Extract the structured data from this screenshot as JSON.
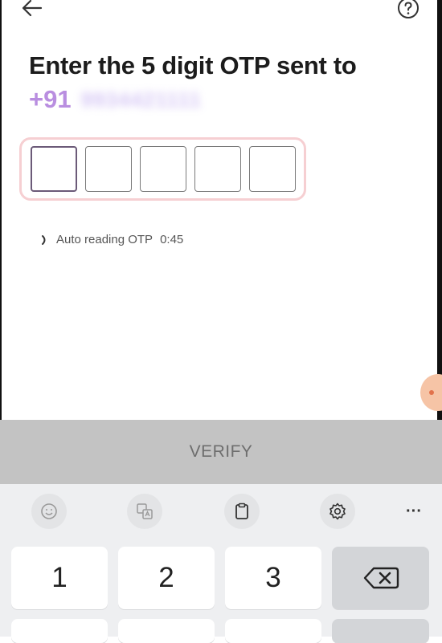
{
  "header": {
    "back_icon": "arrow-left-icon",
    "help_icon": "question-circle-icon"
  },
  "title": "Enter the 5 digit OTP sent to",
  "phone": {
    "country_code": "+91",
    "number": "9934421111"
  },
  "otp": {
    "length": 5,
    "values": [
      "",
      "",
      "",
      "",
      ""
    ],
    "active_index": 0
  },
  "auto_read": {
    "label": "Auto reading OTP",
    "timer": "0:45"
  },
  "verify_label": "VERIFY",
  "keyboard": {
    "toolbar": [
      "emoji-icon",
      "translate-icon",
      "clipboard-icon",
      "settings-icon"
    ],
    "more_label": "···",
    "keys": [
      "1",
      "2",
      "3"
    ],
    "backspace_icon": "backspace-icon"
  },
  "colors": {
    "accent": "#b98ee0",
    "otp_border": "#f6cfd2",
    "verify_bg": "#c3c3c3",
    "fab": "#f6c4a6"
  }
}
